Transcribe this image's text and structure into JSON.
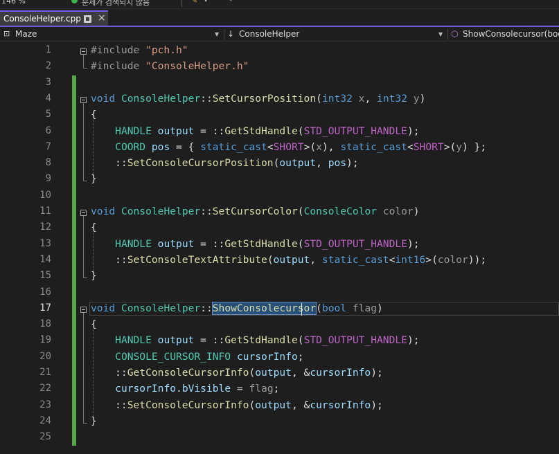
{
  "toolbar": {
    "zoom": "146 %",
    "error_status": "문제가 검색되지 않음"
  },
  "tab": {
    "filename": "ConsoleHelper.cpp",
    "close": "×"
  },
  "navbar": {
    "project": "Maze",
    "scope": "ConsoleHelper",
    "member": "ShowConsolecursor(bool"
  },
  "editor": {
    "current_line": 17,
    "highlighted_word": "ShowConsolecursor",
    "colors": {
      "keyword": "#569cd6",
      "type": "#4ec9b0",
      "function": "#dcdcaa",
      "macro": "#bd63c5",
      "variable": "#9cdcfe",
      "string": "#d69d85",
      "change_bar": "#57a64a"
    },
    "lines": [
      {
        "n": "1",
        "tokens": [
          [
            "pp",
            "#include "
          ],
          [
            "s",
            "\"pch.h\""
          ]
        ]
      },
      {
        "n": "2",
        "tokens": [
          [
            "pp",
            "#include "
          ],
          [
            "s",
            "\"ConsoleHelper.h\""
          ]
        ]
      },
      {
        "n": "3",
        "tokens": []
      },
      {
        "n": "4",
        "tokens": [
          [
            "k",
            "void"
          ],
          [
            "pl",
            " "
          ],
          [
            "t",
            "ConsoleHelper"
          ],
          [
            "pl",
            "::"
          ],
          [
            "f",
            "SetCursorPosition"
          ],
          [
            "pl",
            "("
          ],
          [
            "k",
            "int32"
          ],
          [
            "pl",
            " "
          ],
          [
            "p",
            "x"
          ],
          [
            "pl",
            ", "
          ],
          [
            "k",
            "int32"
          ],
          [
            "pl",
            " "
          ],
          [
            "p",
            "y"
          ],
          [
            "pl",
            ")"
          ]
        ]
      },
      {
        "n": "5",
        "tokens": [
          [
            "pl",
            "{"
          ]
        ]
      },
      {
        "n": "6",
        "tokens": [
          [
            "pl",
            "    "
          ],
          [
            "t",
            "HANDLE"
          ],
          [
            "pl",
            " "
          ],
          [
            "v",
            "output"
          ],
          [
            "pl",
            " = ::"
          ],
          [
            "f",
            "GetStdHandle"
          ],
          [
            "pl",
            "("
          ],
          [
            "m",
            "STD_OUTPUT_HANDLE"
          ],
          [
            "pl",
            ");"
          ]
        ]
      },
      {
        "n": "7",
        "tokens": [
          [
            "pl",
            "    "
          ],
          [
            "t",
            "COORD"
          ],
          [
            "pl",
            " "
          ],
          [
            "v",
            "pos"
          ],
          [
            "pl",
            " = { "
          ],
          [
            "k",
            "static_cast"
          ],
          [
            "pl",
            "<"
          ],
          [
            "m",
            "SHORT"
          ],
          [
            "pl",
            ">("
          ],
          [
            "p",
            "x"
          ],
          [
            "pl",
            "), "
          ],
          [
            "k",
            "static_cast"
          ],
          [
            "pl",
            "<"
          ],
          [
            "m",
            "SHORT"
          ],
          [
            "pl",
            ">("
          ],
          [
            "p",
            "y"
          ],
          [
            "pl",
            ") };"
          ]
        ]
      },
      {
        "n": "8",
        "tokens": [
          [
            "pl",
            "    ::"
          ],
          [
            "f",
            "SetConsoleCursorPosition"
          ],
          [
            "pl",
            "("
          ],
          [
            "v",
            "output"
          ],
          [
            "pl",
            ", "
          ],
          [
            "v",
            "pos"
          ],
          [
            "pl",
            ");"
          ]
        ]
      },
      {
        "n": "9",
        "tokens": [
          [
            "pl",
            "}"
          ]
        ]
      },
      {
        "n": "10",
        "tokens": []
      },
      {
        "n": "11",
        "tokens": [
          [
            "k",
            "void"
          ],
          [
            "pl",
            " "
          ],
          [
            "t",
            "ConsoleHelper"
          ],
          [
            "pl",
            "::"
          ],
          [
            "f",
            "SetCursorColor"
          ],
          [
            "pl",
            "("
          ],
          [
            "t",
            "ConsoleColor"
          ],
          [
            "pl",
            " "
          ],
          [
            "p",
            "color"
          ],
          [
            "pl",
            ")"
          ]
        ]
      },
      {
        "n": "12",
        "tokens": [
          [
            "pl",
            "{"
          ]
        ]
      },
      {
        "n": "13",
        "tokens": [
          [
            "pl",
            "    "
          ],
          [
            "t",
            "HANDLE"
          ],
          [
            "pl",
            " "
          ],
          [
            "v",
            "output"
          ],
          [
            "pl",
            " = ::"
          ],
          [
            "f",
            "GetStdHandle"
          ],
          [
            "pl",
            "("
          ],
          [
            "m",
            "STD_OUTPUT_HANDLE"
          ],
          [
            "pl",
            ");"
          ]
        ]
      },
      {
        "n": "14",
        "tokens": [
          [
            "pl",
            "    ::"
          ],
          [
            "f",
            "SetConsoleTextAttribute"
          ],
          [
            "pl",
            "("
          ],
          [
            "v",
            "output"
          ],
          [
            "pl",
            ", "
          ],
          [
            "k",
            "static_cast"
          ],
          [
            "pl",
            "<"
          ],
          [
            "k",
            "int16"
          ],
          [
            "pl",
            ">("
          ],
          [
            "p",
            "color"
          ],
          [
            "pl",
            "));"
          ]
        ]
      },
      {
        "n": "15",
        "tokens": [
          [
            "pl",
            "}"
          ]
        ]
      },
      {
        "n": "16",
        "tokens": []
      },
      {
        "n": "17",
        "tokens": [
          [
            "k",
            "void"
          ],
          [
            "pl",
            " "
          ],
          [
            "t",
            "ConsoleHelper"
          ],
          [
            "pl",
            "::"
          ],
          [
            "f",
            "ShowConsolecursor"
          ],
          [
            "pl",
            "("
          ],
          [
            "k",
            "bool"
          ],
          [
            "pl",
            " "
          ],
          [
            "p",
            "flag"
          ],
          [
            "pl",
            ")"
          ]
        ]
      },
      {
        "n": "18",
        "tokens": [
          [
            "pl",
            "{"
          ]
        ]
      },
      {
        "n": "19",
        "tokens": [
          [
            "pl",
            "    "
          ],
          [
            "t",
            "HANDLE"
          ],
          [
            "pl",
            " "
          ],
          [
            "v",
            "output"
          ],
          [
            "pl",
            " = ::"
          ],
          [
            "f",
            "GetStdHandle"
          ],
          [
            "pl",
            "("
          ],
          [
            "m",
            "STD_OUTPUT_HANDLE"
          ],
          [
            "pl",
            ");"
          ]
        ]
      },
      {
        "n": "20",
        "tokens": [
          [
            "pl",
            "    "
          ],
          [
            "t",
            "CONSOLE_CURSOR_INFO"
          ],
          [
            "pl",
            " "
          ],
          [
            "v",
            "cursorInfo"
          ],
          [
            "pl",
            ";"
          ]
        ]
      },
      {
        "n": "21",
        "tokens": [
          [
            "pl",
            "    ::"
          ],
          [
            "f",
            "GetConsoleCursorInfo"
          ],
          [
            "pl",
            "("
          ],
          [
            "v",
            "output"
          ],
          [
            "pl",
            ", &"
          ],
          [
            "v",
            "cursorInfo"
          ],
          [
            "pl",
            ");"
          ]
        ]
      },
      {
        "n": "22",
        "tokens": [
          [
            "pl",
            "    "
          ],
          [
            "v",
            "cursorInfo"
          ],
          [
            "pl",
            "."
          ],
          [
            "v",
            "bVisible"
          ],
          [
            "pl",
            " = "
          ],
          [
            "p",
            "flag"
          ],
          [
            "pl",
            ";"
          ]
        ]
      },
      {
        "n": "23",
        "tokens": [
          [
            "pl",
            "    ::"
          ],
          [
            "f",
            "SetConsoleCursorInfo"
          ],
          [
            "pl",
            "("
          ],
          [
            "v",
            "output"
          ],
          [
            "pl",
            ", &"
          ],
          [
            "v",
            "cursorInfo"
          ],
          [
            "pl",
            ");"
          ]
        ]
      },
      {
        "n": "24",
        "tokens": [
          [
            "pl",
            "}"
          ]
        ]
      },
      {
        "n": "25",
        "tokens": []
      }
    ]
  }
}
